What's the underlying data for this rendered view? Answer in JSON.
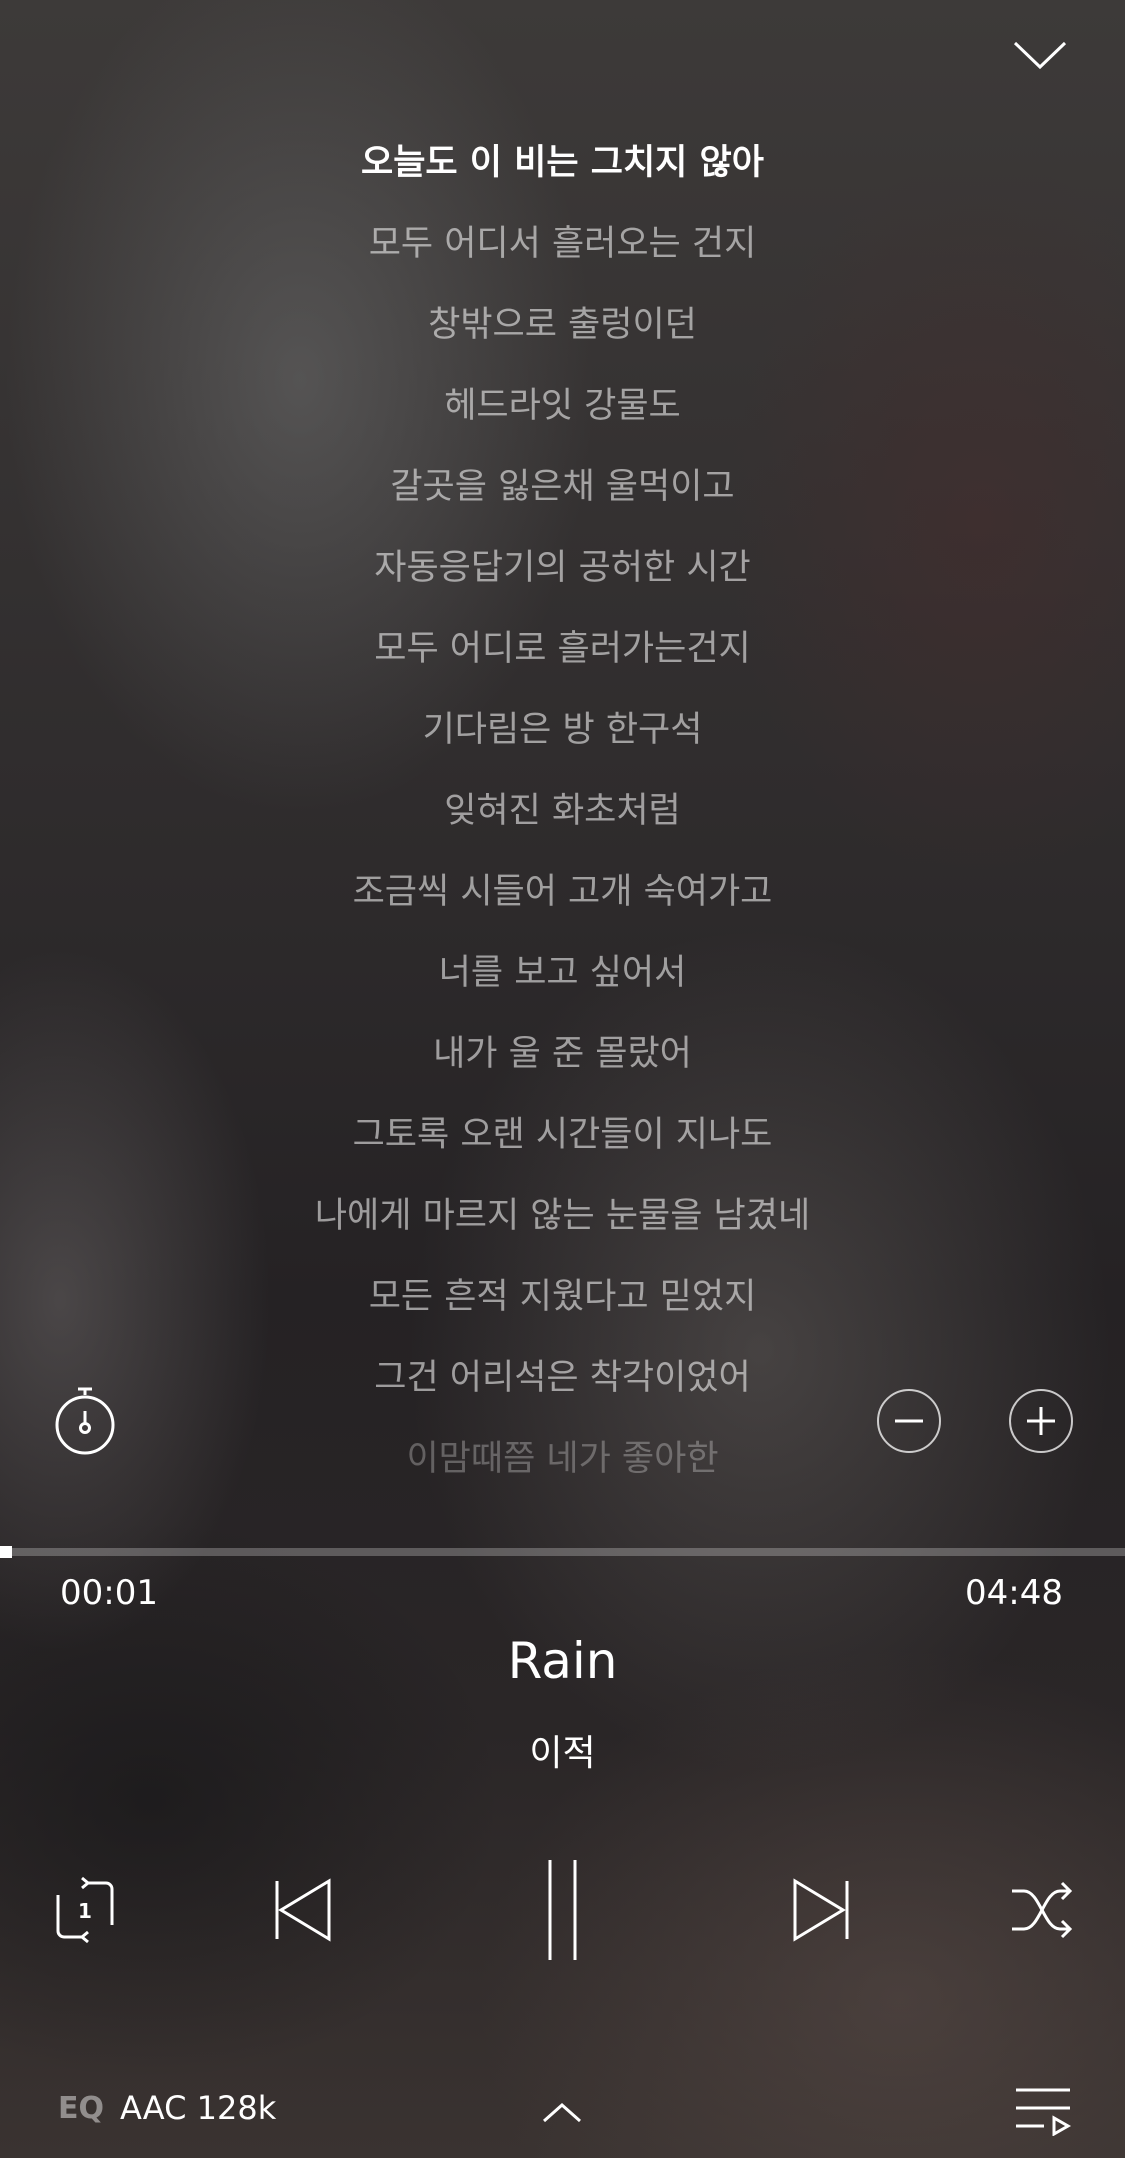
{
  "lyrics": {
    "lines": [
      "오늘도 이 비는 그치지 않아",
      "모두 어디서 흘러오는 건지",
      "창밖으로 출렁이던",
      "헤드라잇 강물도",
      "갈곳을 잃은채 울먹이고",
      "자동응답기의 공허한 시간",
      "모두 어디로 흘러가는건지",
      "기다림은 방 한구석",
      "잊혀진 화초처럼",
      "조금씩 시들어 고개 숙여가고",
      "너를 보고 싶어서",
      "내가 울 준 몰랐어",
      "그토록 오랜 시간들이 지나도",
      "나에게 마르지 않는 눈물을 남겼네",
      "모든 흔적 지웠다고 믿었지",
      "그건 어리석은 착각이었어",
      "이맘때쯤 네가 좋아한"
    ],
    "current_index": 0
  },
  "player": {
    "elapsed": "00:01",
    "duration": "04:48",
    "progress_fraction": 0.0035,
    "track_title": "Rain",
    "artist": "이적"
  },
  "footer": {
    "eq_label": "EQ",
    "quality": "AAC 128k"
  },
  "icons": {
    "collapse": "chevron-down-icon",
    "timer": "timer-icon",
    "font_decrease": "minus-circle-icon",
    "font_increase": "plus-circle-icon",
    "repeat": "repeat-one-icon",
    "previous": "skip-previous-icon",
    "pause": "pause-icon",
    "next": "skip-next-icon",
    "shuffle": "shuffle-icon",
    "expand": "chevron-up-icon",
    "playlist": "playlist-icon"
  },
  "colors": {
    "accent": "#ffffff",
    "dim_text": "rgba(255,255,255,0.55)"
  }
}
